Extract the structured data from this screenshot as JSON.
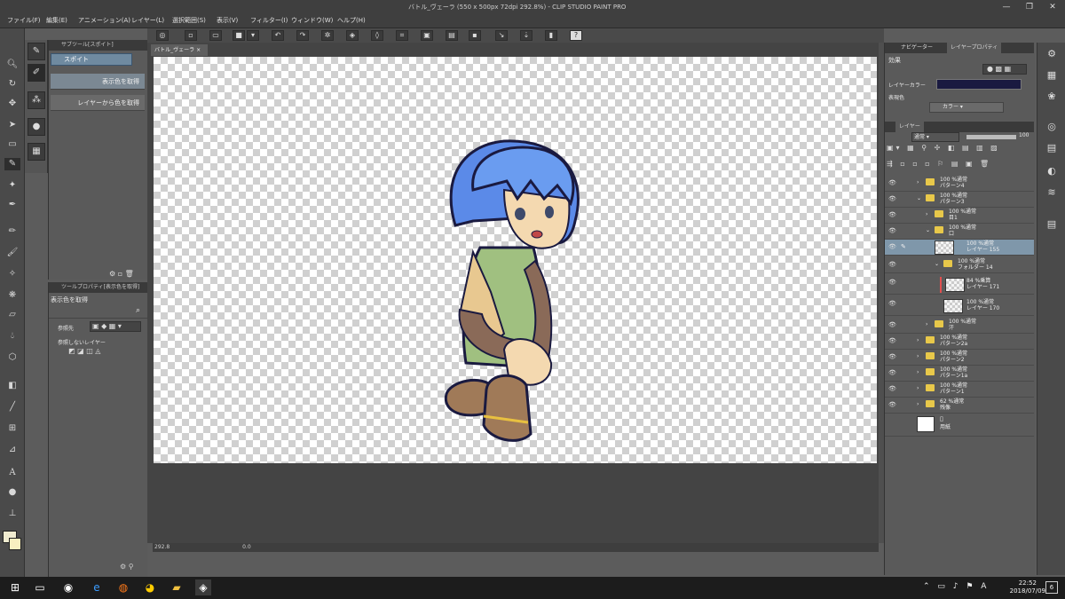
{
  "window": {
    "title": "バトル_ヴェーラ (550 x 500px 72dpi 292.8%) - CLIP STUDIO PAINT PRO",
    "minimize": "—",
    "maximize": "❐",
    "close": "✕"
  },
  "menu": [
    "ファイル(F)",
    "編集(E)",
    "アニメーション(A)",
    "レイヤー(L)",
    "選択範囲(S)",
    "表示(V)",
    "フィルター(I)",
    "ウィンドウ(W)",
    "ヘルプ(H)"
  ],
  "subtool": {
    "panel_title": "サブツール[スポイト]",
    "group_label": "スポイト",
    "items": [
      "表示色を取得",
      "レイヤーから色を取得"
    ]
  },
  "toolprop": {
    "panel_title": "ツールプロパティ[表示色を取得]",
    "tool_name": "表示色を取得",
    "ref_label": "参照先",
    "noref_label": "参照しないレイヤー"
  },
  "canvas": {
    "tab_label": "バトル_ヴェーラ",
    "zoom": "292.8",
    "rotation": "0.0"
  },
  "layerprop": {
    "tab1": "ナビゲーター",
    "tab2": "レイヤープロパティ",
    "effect_label": "効果",
    "layer_color_label": "レイヤーカラー",
    "expression_label": "表現色",
    "expression_value": "カラー"
  },
  "layers": {
    "tab_label": "レイヤー",
    "blend_mode": "通常",
    "opacity": "100",
    "rows": [
      {
        "l1": "100 %通常",
        "l2": "パターン4",
        "indent": 0,
        "type": "folder"
      },
      {
        "l1": "100 %通常",
        "l2": "パターン3",
        "indent": 0,
        "type": "folder"
      },
      {
        "l1": "100 %通常",
        "l2": "目1",
        "indent": 1,
        "type": "folder"
      },
      {
        "l1": "100 %通常",
        "l2": "口",
        "indent": 1,
        "type": "folder"
      },
      {
        "l1": "100 %通常",
        "l2": "レイヤー 155",
        "indent": 2,
        "type": "layer",
        "selected": true
      },
      {
        "l1": "100 %通常",
        "l2": "フォルダー 14",
        "indent": 2,
        "type": "folder"
      },
      {
        "l1": "84 %乗算",
        "l2": "レイヤー 171",
        "indent": 3,
        "type": "layer"
      },
      {
        "l1": "100 %通常",
        "l2": "レイヤー 170",
        "indent": 3,
        "type": "layer"
      },
      {
        "l1": "100 %通常",
        "l2": "汗",
        "indent": 1,
        "type": "folder"
      },
      {
        "l1": "100 %通常",
        "l2": "パターン2a",
        "indent": 0,
        "type": "folder"
      },
      {
        "l1": "100 %通常",
        "l2": "パターン2",
        "indent": 0,
        "type": "folder"
      },
      {
        "l1": "100 %通常",
        "l2": "パターン1a",
        "indent": 0,
        "type": "folder"
      },
      {
        "l1": "100 %通常",
        "l2": "パターン1",
        "indent": 0,
        "type": "folder"
      },
      {
        "l1": "62 %通常",
        "l2": "残像",
        "indent": 0,
        "type": "folder"
      },
      {
        "l1": "",
        "l2": "用紙",
        "indent": 0,
        "type": "paper"
      }
    ]
  },
  "taskbar": {
    "time": "22:52",
    "date": "2018/07/09",
    "notification_count": "6"
  },
  "colors": {
    "main_color": "#f0ecd0",
    "sub_color": "#f8f0c0",
    "layer_color": "#1a1a40"
  }
}
